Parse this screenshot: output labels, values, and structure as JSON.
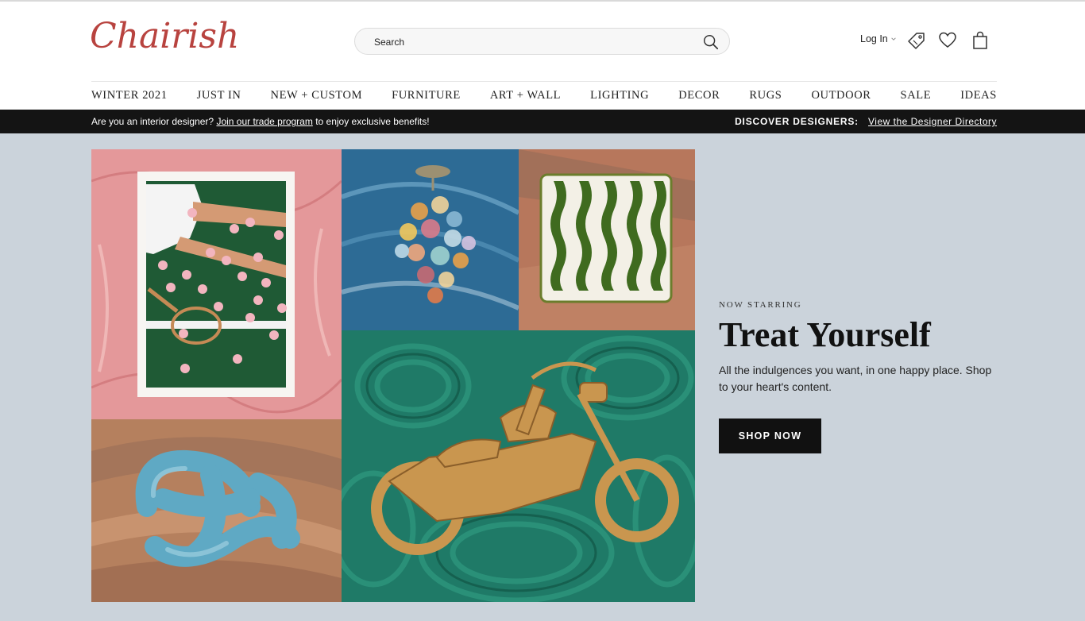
{
  "brand": {
    "logo_text": "Chairish",
    "accent": "#b8433f"
  },
  "search": {
    "placeholder": "Search",
    "icon": "search-icon"
  },
  "header_actions": {
    "login_label": "Log In",
    "icons": [
      "tag-icon",
      "heart-icon",
      "shopping-bag-icon"
    ]
  },
  "nav": {
    "items": [
      "WINTER 2021",
      "JUST IN",
      "NEW + CUSTOM",
      "FURNITURE",
      "ART + WALL",
      "LIGHTING",
      "DECOR",
      "RUGS",
      "OUTDOOR",
      "SALE",
      "IDEAS"
    ]
  },
  "trade_bar": {
    "prefix": "Are you an interior designer?",
    "link": "Join our trade program",
    "suffix": "to enjoy exclusive benefits!",
    "discover_label": "DISCOVER DESIGNERS:",
    "directory_link": "View the Designer Directory"
  },
  "hero": {
    "eyebrow": "NOW STARRING",
    "title": "Treat Yourself",
    "subtitle": "All the indulgences you want, in one happy place. Shop to your heart's content.",
    "cta_label": "SHOP NOW",
    "background": "#cbd3db"
  }
}
